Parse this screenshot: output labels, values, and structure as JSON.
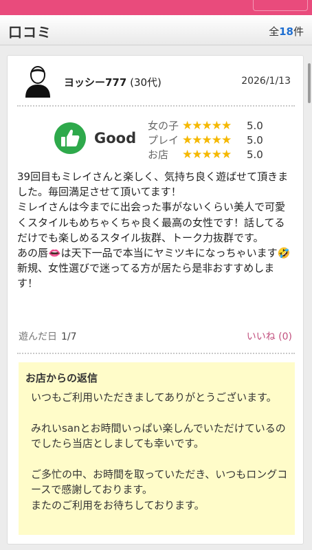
{
  "header": {
    "title": "口コミ",
    "count_prefix": "全",
    "count": "18",
    "count_suffix": "件"
  },
  "review": {
    "reviewer_name": "ヨッシー777",
    "reviewer_age": "(30代)",
    "date": "2026/1/13",
    "verdict": "Good",
    "ratings": [
      {
        "label": "女の子",
        "stars": "★★★★★",
        "score": "5.0"
      },
      {
        "label": "プレイ",
        "stars": "★★★★★",
        "score": "5.0"
      },
      {
        "label": "お店",
        "stars": "★★★★★",
        "score": "5.0"
      }
    ],
    "text": "39回目もミレイさんと楽しく、気持ち良く遊ばせて頂きました。毎回満足させて頂いてます！\nミレイさんは今までに出会った事がないくらい美人で可愛くスタイルもめちゃくちゃ良く最高の女性です！話してるだけでも楽しめるスタイル抜群、トーク力抜群です。\nあの唇👄は天下一品で本当にヤミツキになっちゃいます🤣\n新規、女性選びで迷ってる方が居たら是非おすすめします！",
    "visit_label": "遊んだ日",
    "visit_date": "1/7",
    "like_label": "いいね (0)"
  },
  "reply": {
    "title": "お店からの返信",
    "text": "いつもご利用いただきましてありがとうございます。\n\nみれいsanとお時間いっぱい楽しんでいただけているのでしたら当店としましても幸いです。\n\nご多忙の中、お時間を取っていただき、いつもロングコースで感謝しております。\nまたのご利用をお待ちしております。"
  },
  "colors": {
    "brand_pink": "#e94b7c",
    "count_blue": "#1f6fd1",
    "star_yellow": "#f5b800",
    "good_green": "#2ea94b",
    "reply_bg": "#fffcc9"
  },
  "icons": {
    "avatar": "user-avatar-icon",
    "good": "thumbs-up-icon"
  }
}
